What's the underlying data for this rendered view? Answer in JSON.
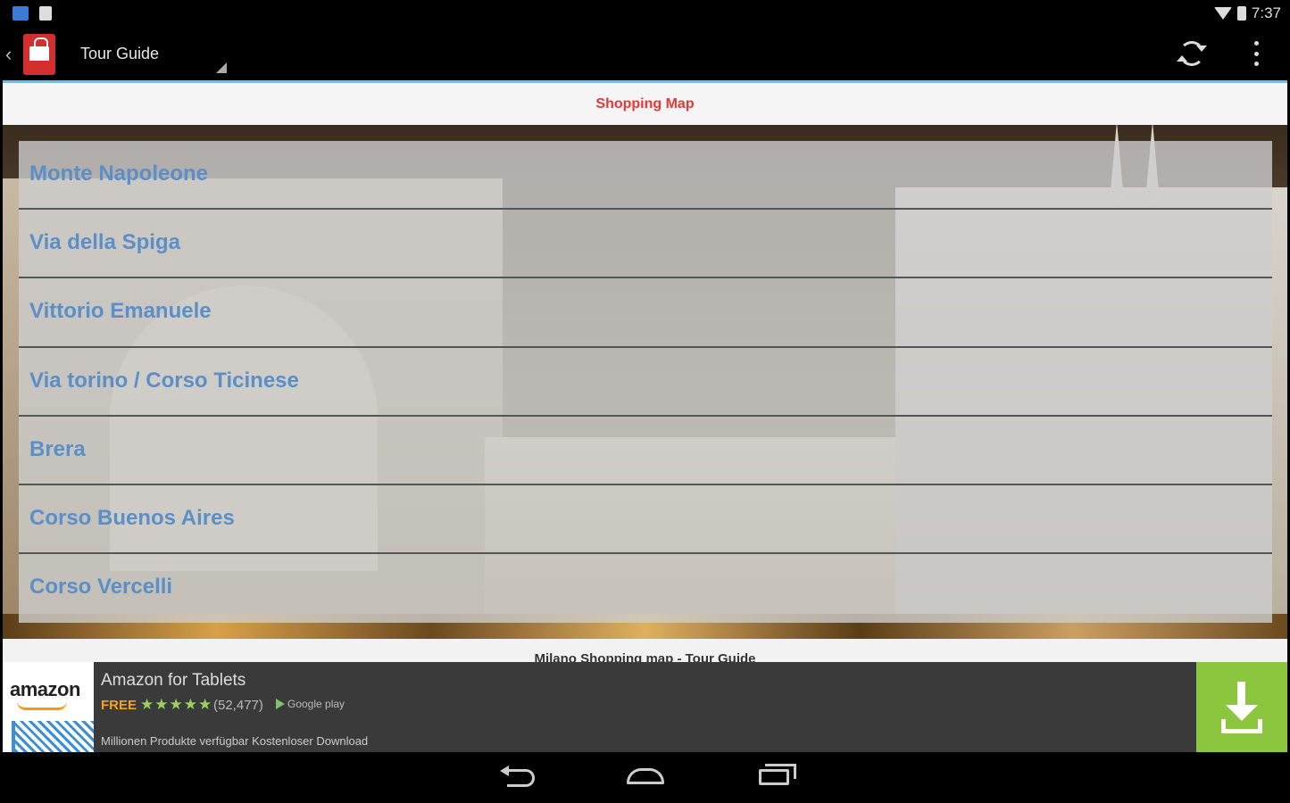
{
  "status_bar": {
    "time": "7:37"
  },
  "action_bar": {
    "title": "Tour Guide"
  },
  "header": {
    "title": "Shopping Map"
  },
  "list": {
    "items": [
      {
        "label": "Monte Napoleone"
      },
      {
        "label": "Via della Spiga"
      },
      {
        "label": "Vittorio Emanuele"
      },
      {
        "label": "Via torino / Corso Ticinese"
      },
      {
        "label": "Brera"
      },
      {
        "label": "Corso Buenos Aires"
      },
      {
        "label": "Corso Vercelli"
      }
    ]
  },
  "caption": "Milano Shopping map - Tour Guide",
  "ad": {
    "logo": "amazon",
    "title": "Amazon for Tablets",
    "price": "FREE",
    "stars": "★★★★★",
    "rating_count": "(52,477)",
    "store": "Google play",
    "description": "Millionen Produkte verfügbar Kostenloser Download"
  },
  "colors": {
    "header_title": "#e53935",
    "list_text": "#5b8fc7",
    "ad_download_bg": "#8cc63f",
    "ad_free": "#f2a51a"
  }
}
